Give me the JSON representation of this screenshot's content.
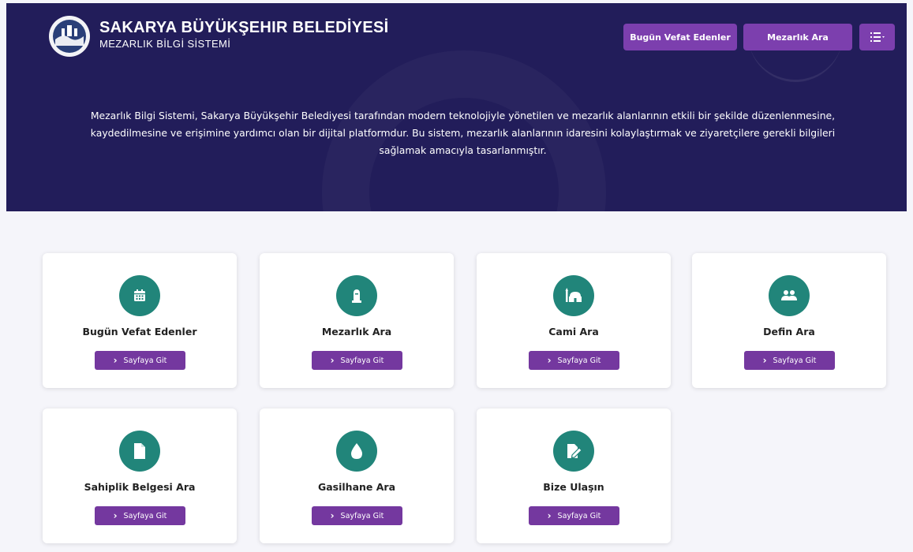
{
  "header": {
    "title": "SAKARYA BÜYÜKŞEHIR BELEDİYESİ",
    "subtitle": "MEZARLIK BİLGİ SİSTEMİ",
    "nav": {
      "today_deaths": "Bugün Vefat Edenler",
      "cemetery_search": "Mezarlık Ara",
      "menu_icon": "list-icon"
    },
    "intro": "Mezarlık Bilgi Sistemi, Sakarya Büyükşehir Belediyesi tarafından modern teknolojiyle yönetilen ve mezarlık alanlarının etkili bir şekilde düzenlenmesine, kaydedilmesine ve erişimine yardımcı olan bir dijital platformdur. Bu sistem, mezarlık alanlarının idaresini kolaylaştırmak ve ziyaretçilere gerekli bilgileri sağlamak amacıyla tasarlanmıştır."
  },
  "colors": {
    "header_bg": "#221d5a",
    "accent_purple": "#7c3fae",
    "icon_teal": "#21857a"
  },
  "cards": [
    {
      "title": "Bugün Vefat Edenler",
      "icon": "calendar-icon",
      "button": "Sayfaya Git"
    },
    {
      "title": "Mezarlık Ara",
      "icon": "tombstone-icon",
      "button": "Sayfaya Git"
    },
    {
      "title": "Cami Ara",
      "icon": "mosque-icon",
      "button": "Sayfaya Git"
    },
    {
      "title": "Defin Ara",
      "icon": "people-icon",
      "button": "Sayfaya Git"
    },
    {
      "title": "Sahiplik Belgesi Ara",
      "icon": "document-icon",
      "button": "Sayfaya Git"
    },
    {
      "title": "Gasilhane Ara",
      "icon": "water-drop-icon",
      "button": "Sayfaya Git"
    },
    {
      "title": "Bize Ulaşın",
      "icon": "edit-icon",
      "button": "Sayfaya Git"
    }
  ]
}
